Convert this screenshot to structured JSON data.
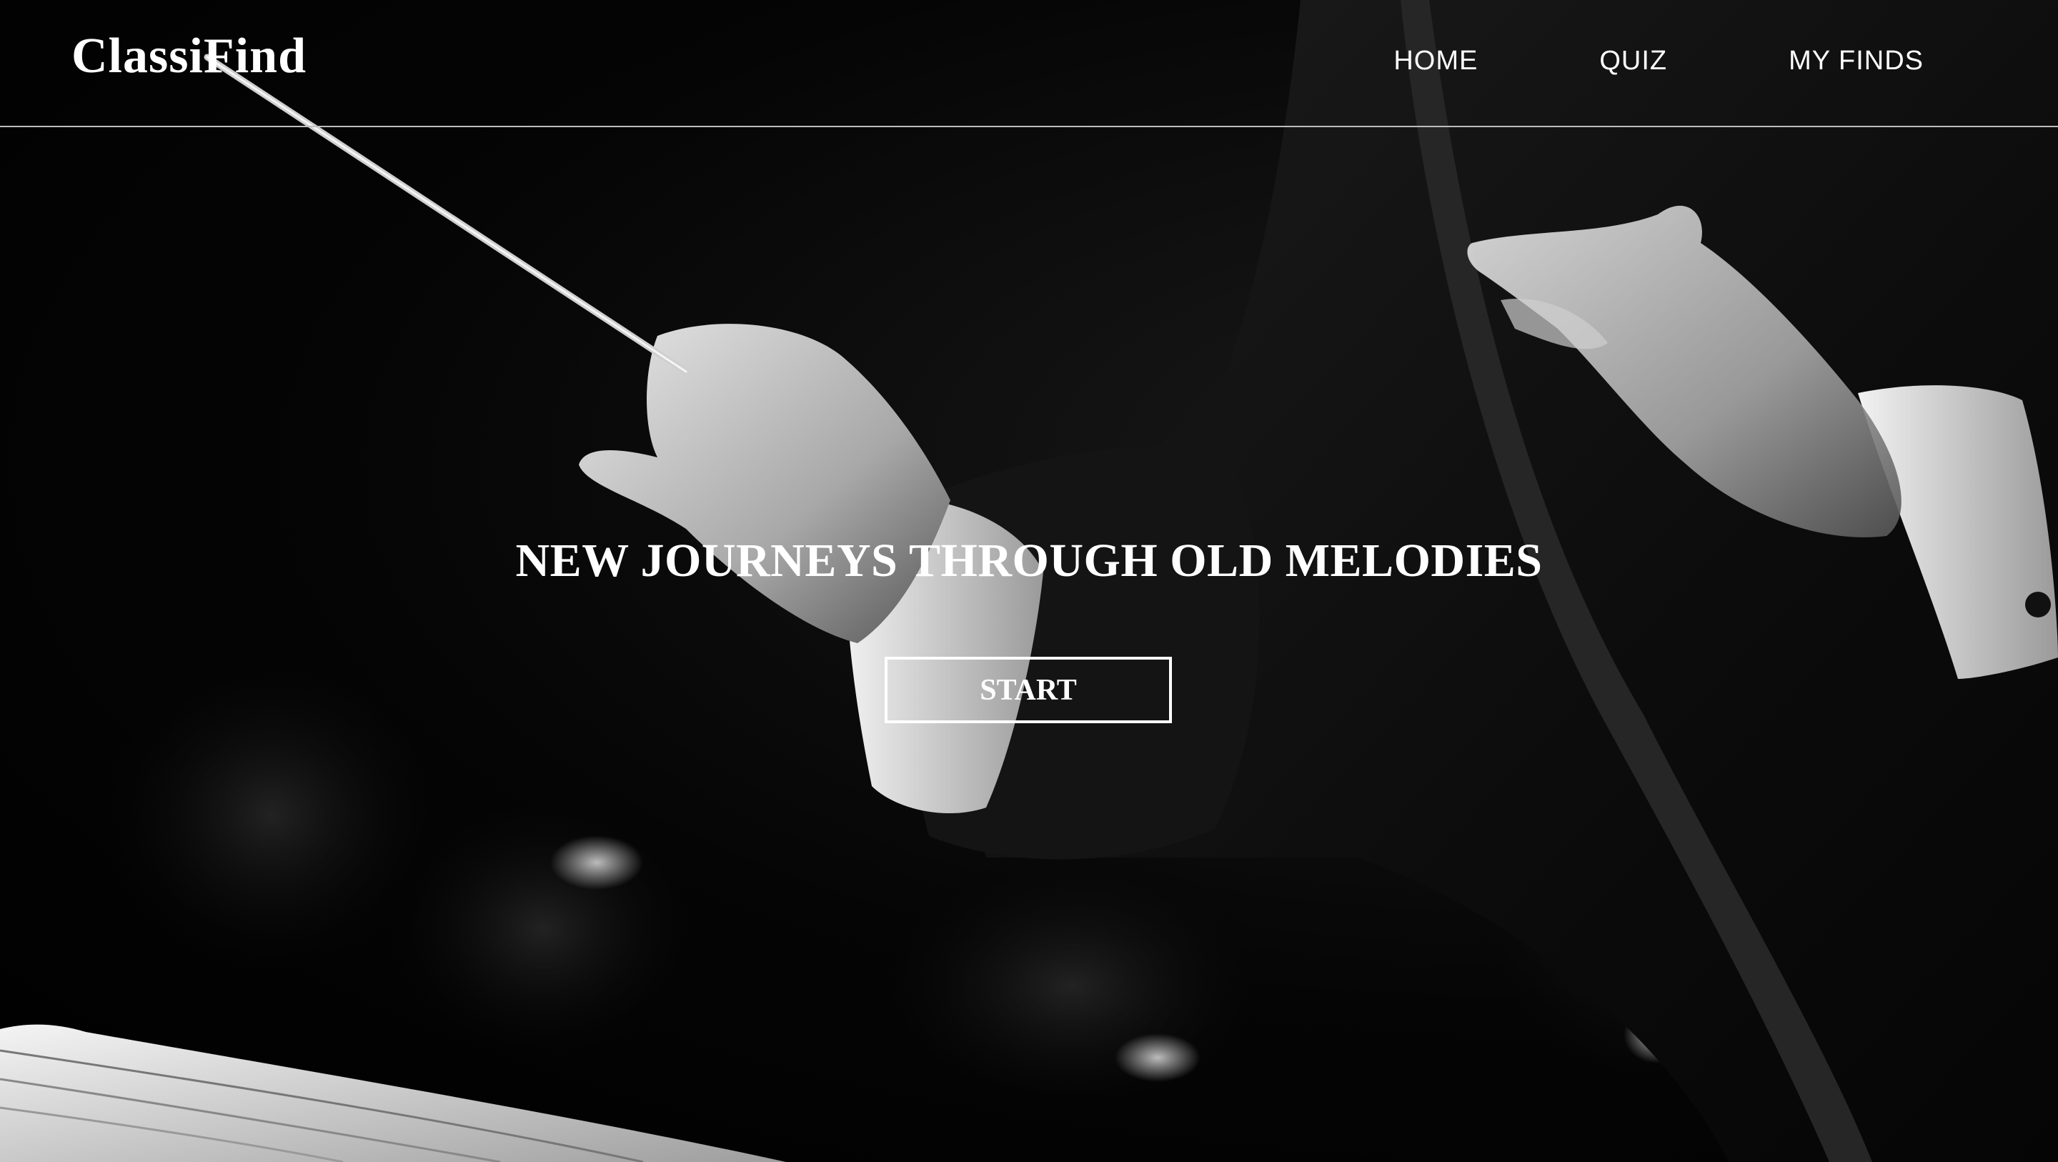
{
  "brand": {
    "logo_text": "ClassiFind"
  },
  "nav": {
    "items": [
      {
        "label": "HOME"
      },
      {
        "label": "QUIZ"
      },
      {
        "label": "MY FINDS"
      }
    ]
  },
  "hero": {
    "headline": "NEW JOURNEYS THROUGH OLD MELODIES",
    "start_label": "START",
    "image_subject": "conductor-hands-with-baton"
  },
  "colors": {
    "background": "#000000",
    "text": "#ffffff",
    "divider": "#bdbdbd"
  }
}
